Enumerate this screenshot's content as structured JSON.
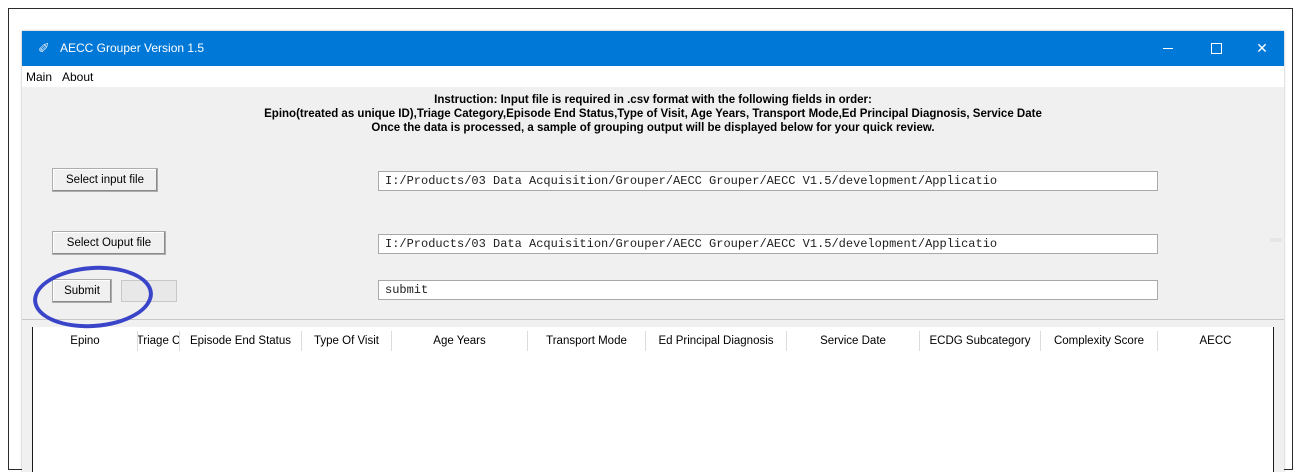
{
  "window": {
    "title": "AECC Grouper Version 1.5",
    "titlebar_color": "#0078d7",
    "controls": {
      "minimize": "minimize-icon",
      "maximize": "maximize-icon",
      "close": "close-icon"
    }
  },
  "menu": {
    "items": [
      "Main",
      "About"
    ]
  },
  "instructions": {
    "line1": "Instruction: Input file is required in .csv format with the following fields in order:",
    "line2": "Epino(treated as unique ID),Triage Category,Episode End Status,Type of Visit, Age Years, Transport Mode,Ed Principal Diagnosis, Service Date",
    "line3": "Once the data is processed, a sample of grouping output will be displayed below for your quick review."
  },
  "input_file": {
    "button_label": "Select input file",
    "path": "I:/Products/03 Data Acquisition/Grouper/AECC Grouper/AECC V1.5/development/Applicatio"
  },
  "output_file": {
    "button_label": "Select Ouput file",
    "path": "I:/Products/03 Data Acquisition/Grouper/AECC Grouper/AECC V1.5/development/Applicatio"
  },
  "submit": {
    "button_label": "Submit",
    "status": "submit"
  },
  "table": {
    "columns": [
      "Epino",
      "Triage C",
      "Episode End Status",
      "Type Of Visit",
      "Age Years",
      "Transport Mode",
      "Ed Principal Diagnosis",
      "Service Date",
      "ECDG Subcategory",
      "Complexity Score",
      "AECC"
    ],
    "rows": []
  },
  "annotation": {
    "color": "#3a44c9"
  }
}
